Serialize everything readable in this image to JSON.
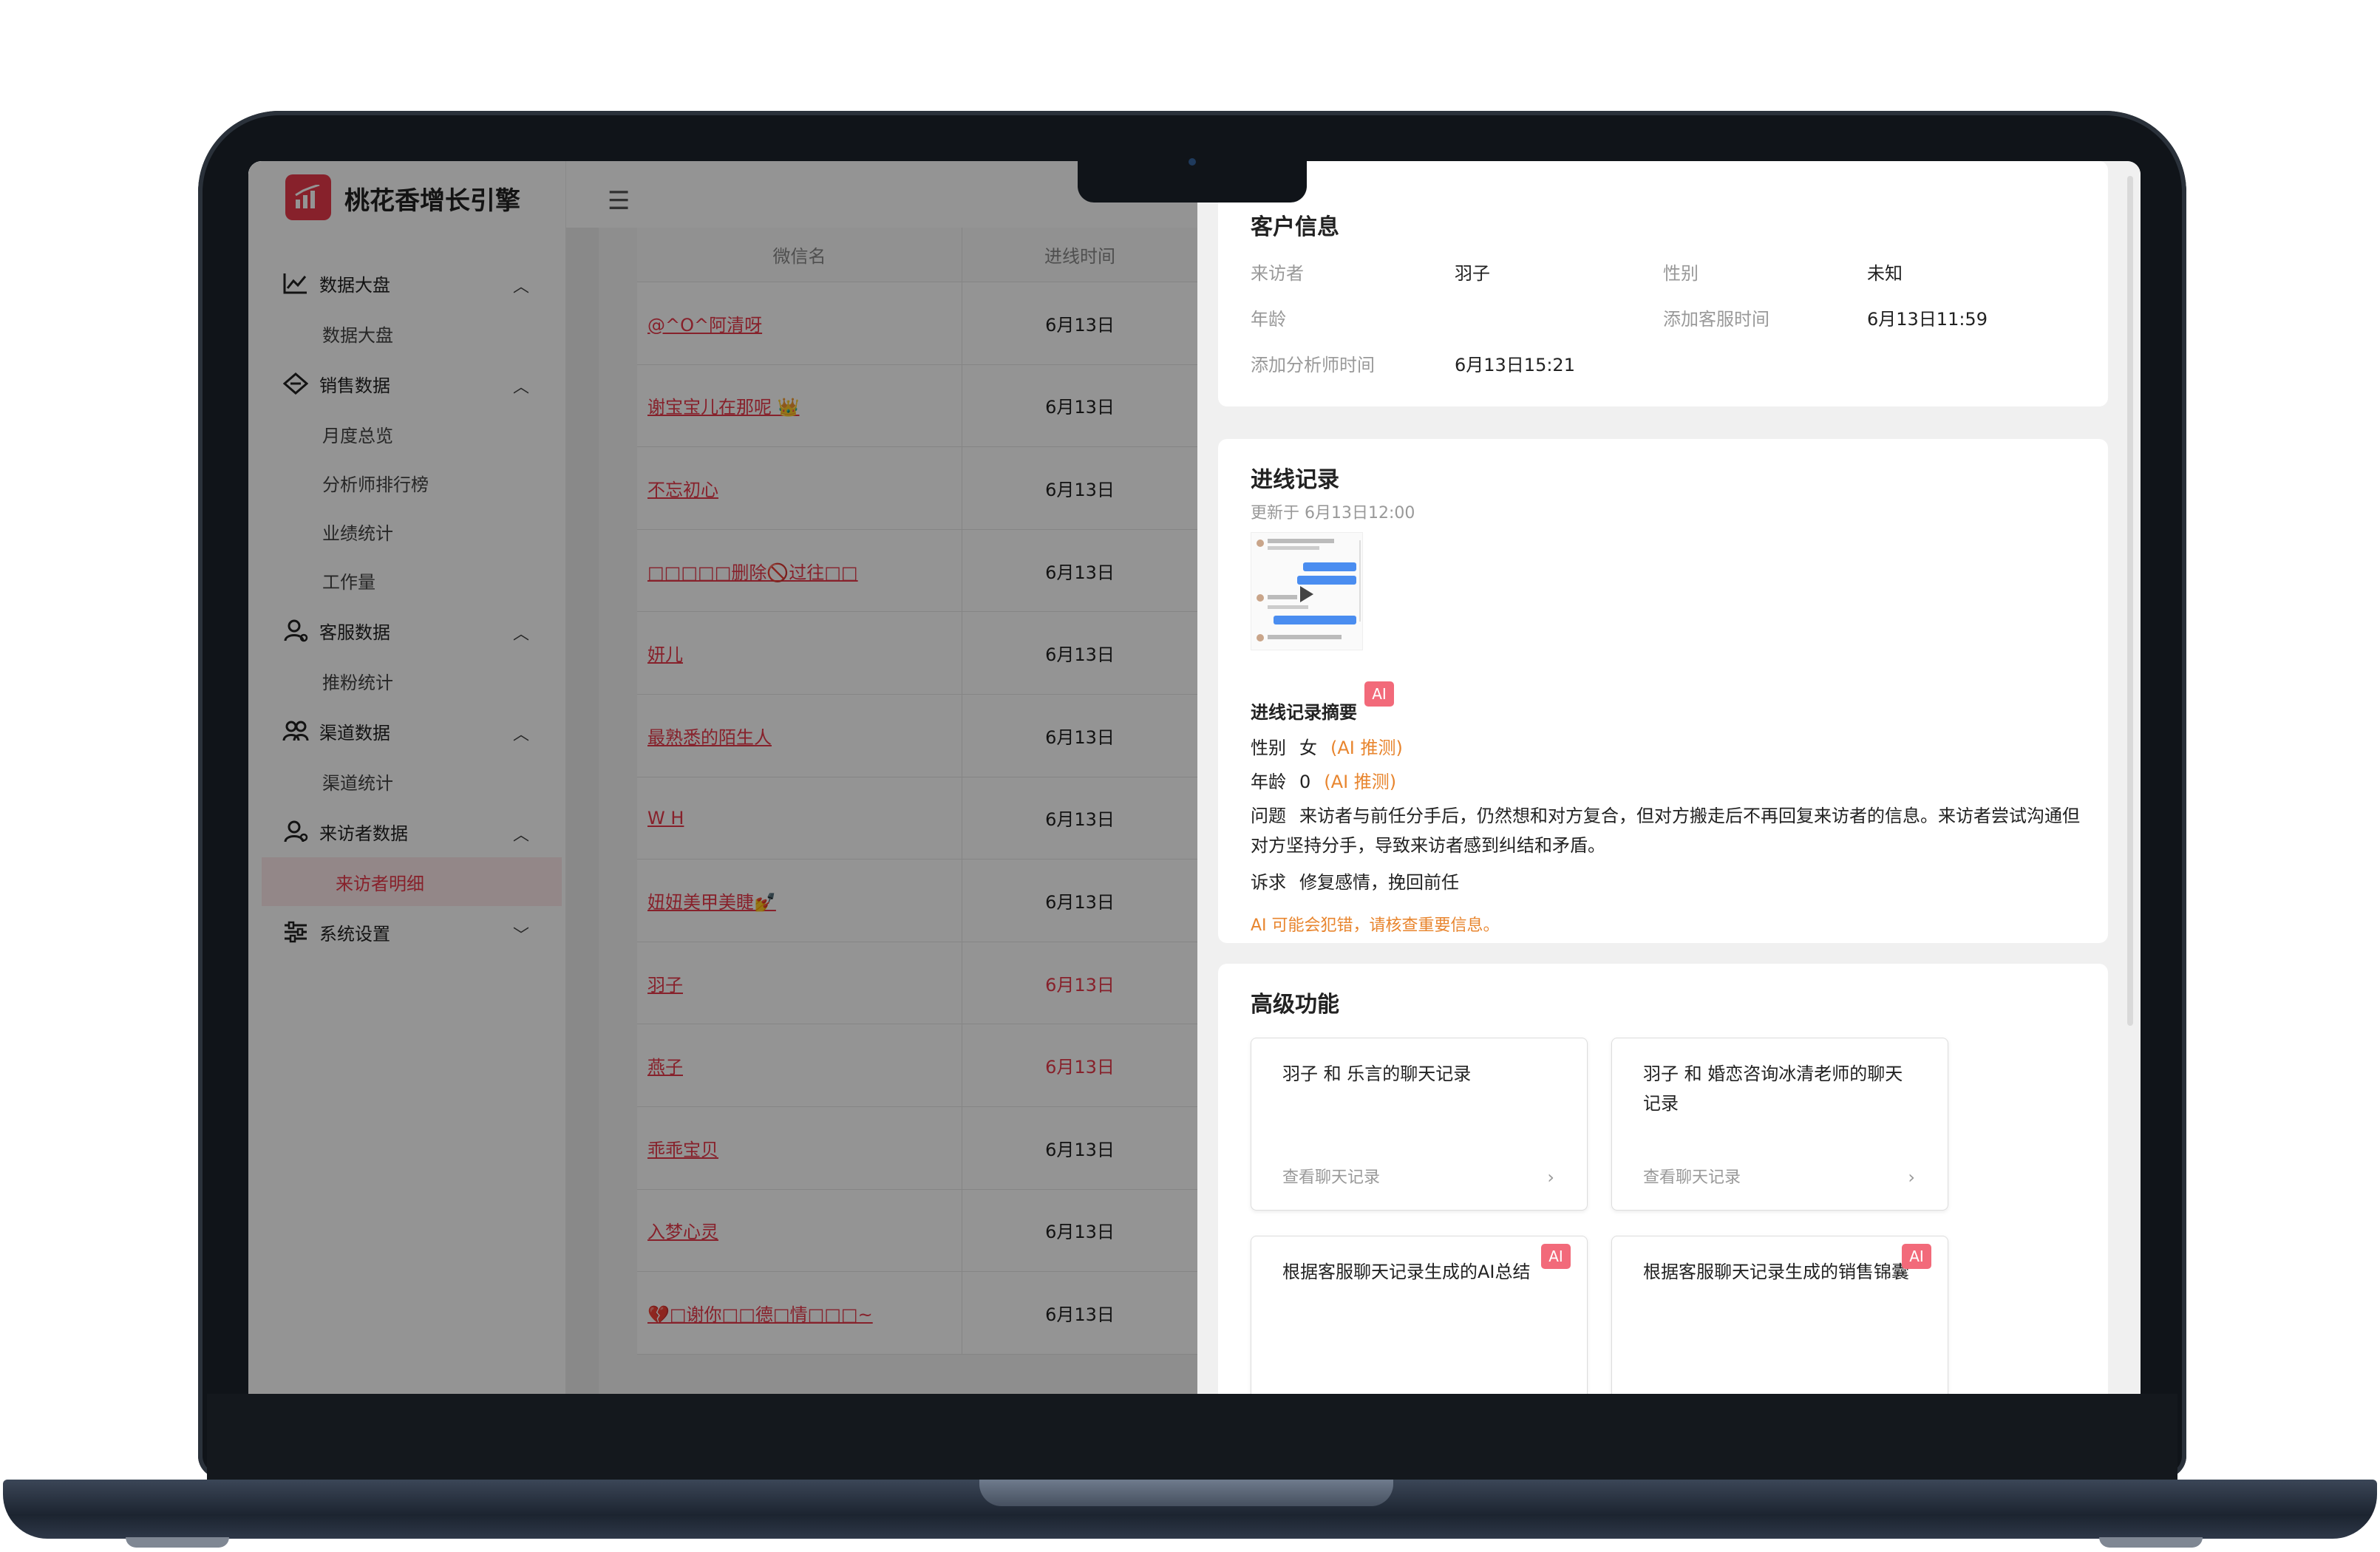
{
  "app": {
    "brand": "桃花香增长引擎",
    "menu_icon": "menu-icon"
  },
  "sidebar": {
    "groups": [
      {
        "label": "数据大盘",
        "icon": "chart-line-icon",
        "expanded": true,
        "items": [
          "数据大盘"
        ]
      },
      {
        "label": "销售数据",
        "icon": "diamond-tag-icon",
        "expanded": true,
        "items": [
          "月度总览",
          "分析师排行榜",
          "业绩统计",
          "工作量"
        ]
      },
      {
        "label": "客服数据",
        "icon": "user-service-icon",
        "expanded": true,
        "items": [
          "推粉统计"
        ]
      },
      {
        "label": "渠道数据",
        "icon": "users-icon",
        "expanded": true,
        "items": [
          "渠道统计"
        ]
      },
      {
        "label": "来访者数据",
        "icon": "visitor-icon",
        "expanded": true,
        "items": [
          "来访者明细"
        ]
      },
      {
        "label": "系统设置",
        "icon": "sliders-icon",
        "expanded": false,
        "items": []
      }
    ],
    "active_item": "来访者明细"
  },
  "table": {
    "columns": [
      "微信名",
      "进线时间"
    ],
    "rows": [
      {
        "name": "@^O^阿清呀",
        "time": "6月13日"
      },
      {
        "name": "谢宝宝儿在那呢 👑",
        "time": "6月13日"
      },
      {
        "name": "不忘初心",
        "time": "6月13日"
      },
      {
        "name": "□□□□□删除🚫过往□□",
        "time": "6月13日"
      },
      {
        "name": "妍儿",
        "time": "6月13日"
      },
      {
        "name": "最熟悉的陌生人",
        "time": "6月13日"
      },
      {
        "name": "W H",
        "time": "6月13日"
      },
      {
        "name": "妞妞美甲美睫💅",
        "time": "6月13日"
      },
      {
        "name": "羽子",
        "time": "6月13日"
      },
      {
        "name": "燕子",
        "time": "6月13日"
      },
      {
        "name": "乖乖宝贝",
        "time": "6月13日"
      },
      {
        "name": "入梦心灵",
        "time": "6月13日"
      },
      {
        "name": "💔□谢你□□德□情□□□~",
        "time": "6月13日"
      }
    ]
  },
  "customer": {
    "title": "客户信息",
    "fields": [
      {
        "label": "来访者",
        "value": "羽子"
      },
      {
        "label": "性别",
        "value": "未知"
      },
      {
        "label": "年龄",
        "value": ""
      },
      {
        "label": "添加客服时间",
        "value": "6月13日11:59"
      },
      {
        "label": "添加分析师时间",
        "value": "6月13日15:21"
      }
    ]
  },
  "record": {
    "title": "进线记录",
    "updated": "更新于 6月13日12:00",
    "summary_title": "进线记录摘要",
    "ai_badge": "AI",
    "gender_label": "性别",
    "gender_value": "女",
    "gender_note": "(AI 推测)",
    "age_label": "年龄",
    "age_value": "0",
    "age_note": "(AI 推测)",
    "problem_label": "问题",
    "problem_text": "来访者与前任分手后，仍然想和对方复合，但对方搬走后不再回复来访者的信息。来访者尝试沟通但对方坚持分手，导致来访者感到纠结和矛盾。",
    "demand_label": "诉求",
    "demand_text": "修复感情，挽回前任",
    "warning": "AI 可能会犯错，请核查重要信息。"
  },
  "advanced": {
    "title": "高级功能",
    "cards": [
      {
        "title": "羽子 和 乐言的聊天记录",
        "link": "查看聊天记录",
        "ai": false
      },
      {
        "title": "羽子 和 婚恋咨询冰清老师的聊天记录",
        "link": "查看聊天记录",
        "ai": false
      },
      {
        "title": "根据客服聊天记录生成的AI总结",
        "link": "",
        "ai": true
      },
      {
        "title": "根据客服聊天记录生成的销售锦囊",
        "link": "",
        "ai": true
      }
    ]
  },
  "colors": {
    "accent": "#e83a4b",
    "ai_orange": "#e8852e",
    "ai_badge": "#f26a7a"
  }
}
